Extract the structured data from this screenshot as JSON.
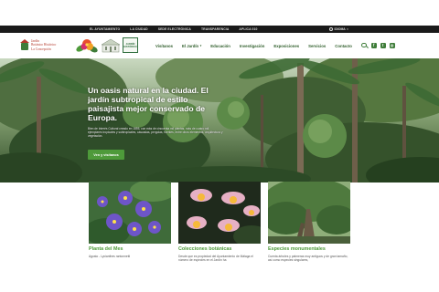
{
  "topbar": {
    "links": [
      "EL AYUNTAMIENTO",
      "LA CIUDAD",
      "SEDE ELECTRÓNICA",
      "TRANSPARENCIA",
      "APLICA 010"
    ],
    "language_label": "IDIOMA",
    "language_icon": "globe-icon"
  },
  "header": {
    "logo_lines": [
      "Jardín",
      "Botánico Histórico",
      "La Concepción"
    ],
    "badge_text": "JARDÍN HISTÓRICO",
    "nav": [
      {
        "label": "Visítanos",
        "has_dropdown": false
      },
      {
        "label": "El Jardín",
        "has_dropdown": true
      },
      {
        "label": "Educación",
        "has_dropdown": false
      },
      {
        "label": "Investigación",
        "has_dropdown": false
      },
      {
        "label": "Exposiciones",
        "has_dropdown": false
      },
      {
        "label": "Servicios",
        "has_dropdown": false
      },
      {
        "label": "Contacto",
        "has_dropdown": false
      }
    ],
    "tool_icons": [
      "search-icon",
      "facebook-icon",
      "twitter-icon",
      "instagram-icon"
    ]
  },
  "hero": {
    "title": "Un oasis natural en la ciudad. El jardín subtropical de estilo paisajista mejor conservado de Europa.",
    "description": "Bien de Interés Cultural creado en 1855, con más de cincuenta mil plantas, más de cuatro mil ejemplares tropicales y subtropicales, cascadas, pergolas, fuentes, entre otros elementos, arquitectura y vegetación.",
    "button_label": "Ven y visítanos"
  },
  "cards": [
    {
      "title": "Planta del Mes",
      "text": "Agosto - Lycianthes rantonnetii"
    },
    {
      "title": "Colecciones botánicas",
      "text": "Desde que es propiedad del Ayuntamiento de Málaga el número de especies en el Jardín ha"
    },
    {
      "title": "Especies monumentales",
      "text": "Cuenta árboles y palmeras muy antiguos y de gran tamaño, así como especies singulares,"
    }
  ],
  "colors": {
    "accent_green": "#4e9a3a",
    "nav_green": "#2e5d2a",
    "topbar_bg": "#1a1a1a",
    "logo_red": "#b33a2c"
  }
}
